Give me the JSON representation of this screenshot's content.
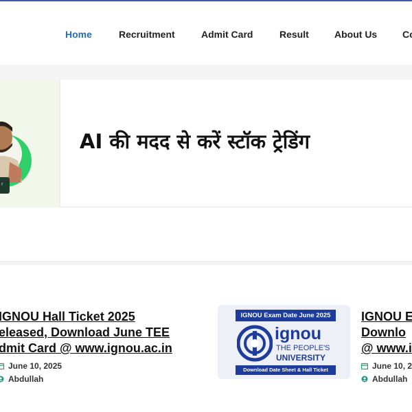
{
  "nav": {
    "items": [
      {
        "label": "Home",
        "active": true
      },
      {
        "label": "Recruitment"
      },
      {
        "label": "Admit Card"
      },
      {
        "label": "Result"
      },
      {
        "label": "About Us"
      },
      {
        "label": "Co"
      }
    ]
  },
  "banner": {
    "title": "AI की मदद से करें स्टॉक ट्रेडिंग",
    "thumbnail_icon": "person-photo"
  },
  "posts": [
    {
      "title_lines": [
        "IGNOU Hall Ticket 2025",
        "eleased, Download June TEE",
        "dmit Card @ www.ignou.ac.in"
      ],
      "date": "June 10, 2025",
      "author": "Abdullah"
    },
    {
      "thumbnail": {
        "top_text": "IGNOU Exam Date June 2025",
        "logo_text": "ignou",
        "sub1": "THE PEOPLE'S",
        "sub2": "UNIVERSITY",
        "bottom_text": "Download Date Sheet & Hall Ticket"
      },
      "title_lines": [
        "IGNOU E",
        "Downlo",
        "@ www.i"
      ],
      "date": "June 10, 2",
      "author": "Abdullah"
    }
  ],
  "colors": {
    "accent": "#2a6db5",
    "meta_icon": "#1a9a7a",
    "ignou_blue": "#1d3c9c"
  }
}
